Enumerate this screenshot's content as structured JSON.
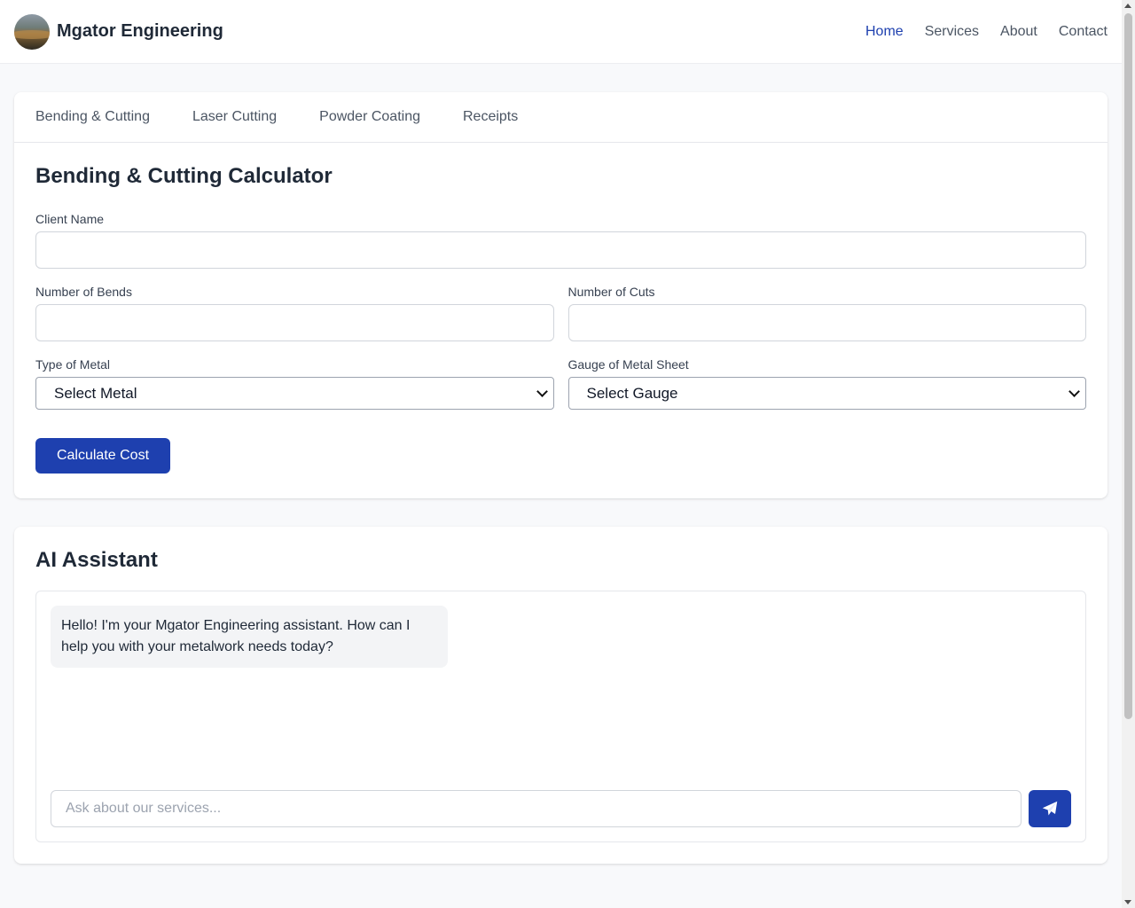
{
  "header": {
    "brand_name": "Mgator Engineering",
    "nav": [
      "Home",
      "Services",
      "About",
      "Contact"
    ],
    "active_nav": "Home"
  },
  "tabs": [
    "Bending & Cutting",
    "Laser Cutting",
    "Powder Coating",
    "Receipts"
  ],
  "calculator": {
    "title": "Bending & Cutting Calculator",
    "client_name": {
      "label": "Client Name",
      "value": ""
    },
    "bends": {
      "label": "Number of Bends",
      "value": ""
    },
    "cuts": {
      "label": "Number of Cuts",
      "value": ""
    },
    "metal": {
      "label": "Type of Metal",
      "selected": "Select Metal"
    },
    "gauge": {
      "label": "Gauge of Metal Sheet",
      "selected": "Select Gauge"
    },
    "button_label": "Calculate Cost"
  },
  "assistant": {
    "title": "AI Assistant",
    "messages": [
      {
        "role": "assistant",
        "text": "Hello! I'm your Mgator Engineering assistant. How can I help you with your metalwork needs today?"
      }
    ],
    "input_placeholder": "Ask about our services...",
    "send_icon": "paper-plane-icon"
  },
  "colors": {
    "accent": "#1e40af",
    "background": "#f8f9fb",
    "bubble": "#f3f4f6"
  }
}
